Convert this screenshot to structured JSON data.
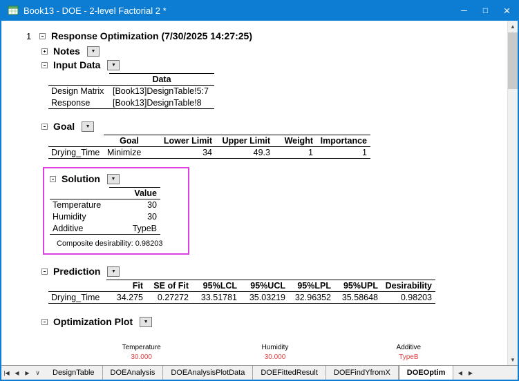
{
  "window": {
    "title": "Book13 - DOE - 2-level Factorial 2 *"
  },
  "titlebar_icons": {
    "minimize": "─",
    "maximize": "□",
    "close": "×"
  },
  "ui": {
    "caret": "▼"
  },
  "report": {
    "line_number": "1",
    "title": "Response Optimization (7/30/2025 14:27:25)",
    "sections": {
      "notes": {
        "label": "Notes"
      },
      "input_data": {
        "label": "Input Data",
        "col_header": "Data",
        "rows": [
          {
            "name": "Design Matrix",
            "value": "[Book13]DesignTable!5:7"
          },
          {
            "name": "Response",
            "value": "[Book13]DesignTable!8"
          }
        ]
      },
      "goal": {
        "label": "Goal",
        "headers": [
          "Goal",
          "Lower Limit",
          "Upper Limit",
          "Weight",
          "Importance"
        ],
        "row": {
          "name": "Drying_Time",
          "goal": "Minimize",
          "lower_limit": "34",
          "upper_limit": "49.3",
          "weight": "1",
          "importance": "1"
        }
      },
      "solution": {
        "label": "Solution",
        "col_header": "Value",
        "rows": [
          {
            "name": "Temperature",
            "value": "30"
          },
          {
            "name": "Humidity",
            "value": "30"
          },
          {
            "name": "Additive",
            "value": "TypeB"
          }
        ],
        "footnote": "Composite desirability: 0.98203"
      },
      "prediction": {
        "label": "Prediction",
        "headers": [
          "Fit",
          "SE of Fit",
          "95%LCL",
          "95%UCL",
          "95%LPL",
          "95%UPL",
          "Desirability"
        ],
        "row": {
          "name": "Drying_Time",
          "values": [
            "34.275",
            "0.27272",
            "33.51781",
            "35.03219",
            "32.96352",
            "35.58648",
            "0.98203"
          ]
        }
      },
      "optimization_plot": {
        "label": "Optimization Plot",
        "factors": [
          {
            "name": "Temperature",
            "value": "30.000"
          },
          {
            "name": "Humidity",
            "value": "30.000"
          },
          {
            "name": "Additive",
            "value": "TypeB"
          }
        ]
      }
    }
  },
  "sheet_tabs": {
    "nav": {
      "first": "|◀",
      "prev": "◀",
      "next": "▶",
      "list": "∨"
    },
    "items": [
      "DesignTable",
      "DOEAnalysis",
      "DOEAnalysisPlotData",
      "DOEFittedResult",
      "DOEFindYfromX",
      "DOEOptim"
    ],
    "active": "DOEOptim",
    "scroll_left": "◀",
    "scroll_right": "▶"
  },
  "scrollbar": {
    "up": "▲",
    "down": "▼"
  },
  "colors": {
    "titlebar": "#0d7dd4",
    "highlight_box": "#e13ee1",
    "factor_value": "#e04040"
  }
}
